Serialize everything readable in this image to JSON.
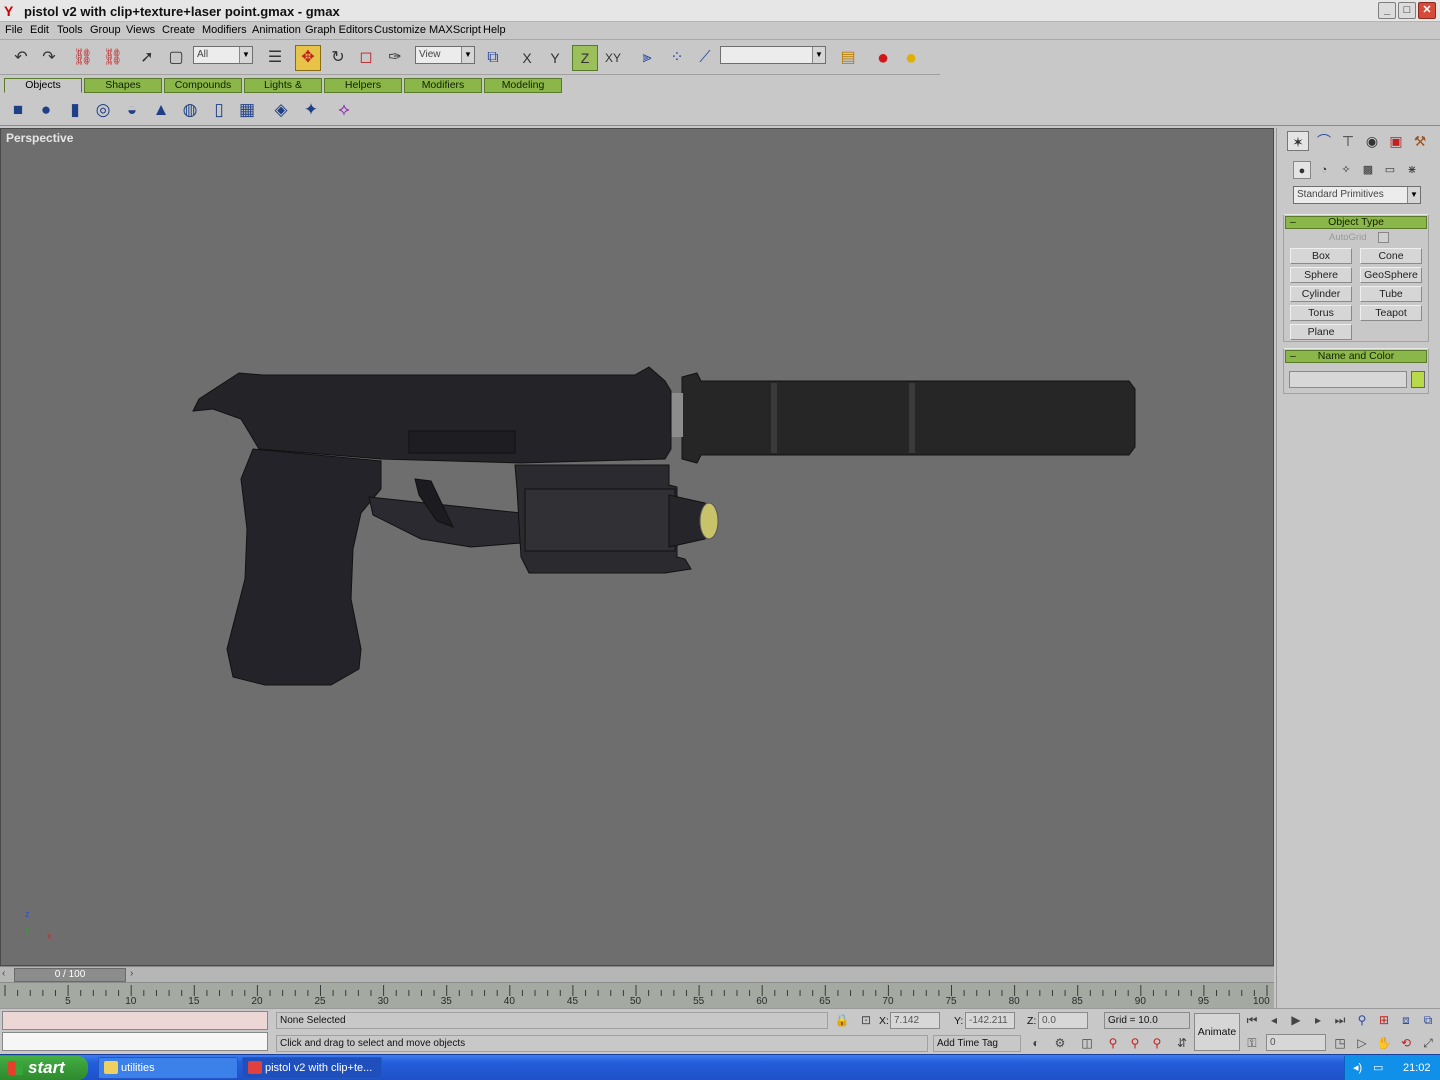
{
  "window": {
    "title": "pistol v2 with clip+texture+laser point.gmax - gmax",
    "controls": [
      "_",
      "□",
      "✕"
    ]
  },
  "menu": [
    "File",
    "Edit",
    "Tools",
    "Group",
    "Views",
    "Create",
    "Modifiers",
    "Animation",
    "Graph Editors",
    "Customize",
    "MAXScript",
    "Help"
  ],
  "toolbar": {
    "selection_filter": "All",
    "ref_coord": "View",
    "named_selection": "",
    "axis_labels": [
      "X",
      "Y",
      "Z",
      "XY"
    ]
  },
  "tabs": [
    "Objects",
    "Shapes",
    "Compounds",
    "Lights & Cameras",
    "Helpers",
    "Modifiers",
    "Modeling"
  ],
  "viewport": {
    "label": "Perspective",
    "axis": {
      "x": "x",
      "y": "y",
      "z": "z"
    }
  },
  "command_panel": {
    "category": "Standard Primitives",
    "object_type_title": "Object Type",
    "autogrid_label": "AutoGrid",
    "buttons": [
      "Box",
      "Cone",
      "Sphere",
      "GeoSphere",
      "Cylinder",
      "Tube",
      "Torus",
      "Teapot",
      "Plane"
    ],
    "name_color_title": "Name and Color",
    "name_value": "",
    "swatch_color": "#b9d94a"
  },
  "timeline": {
    "frame": "0 / 100",
    "ticks": [
      "5",
      "10",
      "15",
      "20",
      "25",
      "30",
      "35",
      "40",
      "45",
      "50",
      "55",
      "60",
      "65",
      "70",
      "75",
      "80",
      "85",
      "90",
      "95",
      "100"
    ]
  },
  "status": {
    "selection": "None Selected",
    "prompt": "Click and drag to select and move objects",
    "x_label": "X:",
    "x_value": "7.142",
    "y_label": "Y:",
    "y_value": "-142.211",
    "z_label": "Z:",
    "z_value": "0.0",
    "grid": "Grid = 10.0",
    "add_time_tag": "Add Time Tag",
    "animate": "Animate",
    "frame_field": "0"
  },
  "taskbar": {
    "start": "start",
    "items": [
      "utilities",
      "pistol v2 with clip+te..."
    ],
    "clock": "21:02"
  },
  "colors": {
    "tab_green": "#8bb74a",
    "active_tool": "#e8c34a",
    "viewport_bg": "#6e6e6e"
  }
}
